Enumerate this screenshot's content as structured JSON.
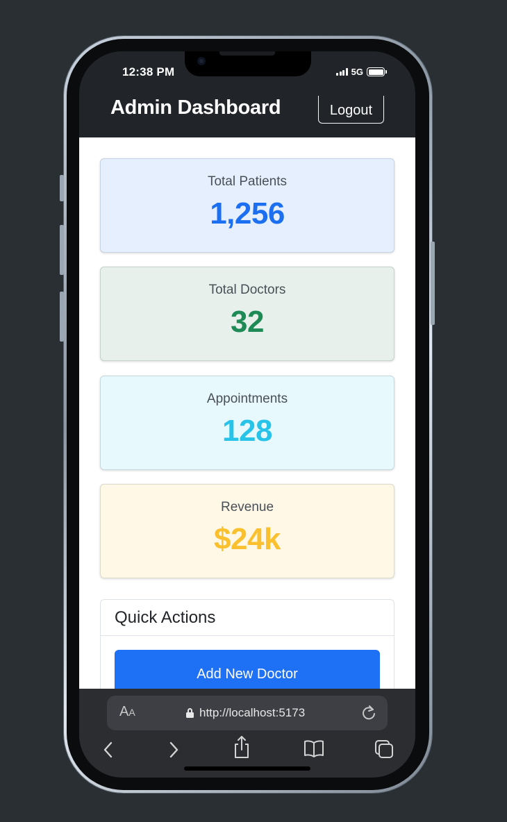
{
  "status_bar": {
    "time": "12:38 PM",
    "network": "5G"
  },
  "navbar": {
    "title": "Admin Dashboard",
    "logout_label": "Logout"
  },
  "stats": [
    {
      "label": "Total Patients",
      "value": "1,256",
      "color": "#1d6ff2"
    },
    {
      "label": "Total Doctors",
      "value": "32",
      "color": "#1e8a55"
    },
    {
      "label": "Appointments",
      "value": "128",
      "color": "#27c3e8"
    },
    {
      "label": "Revenue",
      "value": "$24k",
      "color": "#fbc02d"
    }
  ],
  "quick_actions": {
    "title": "Quick Actions",
    "add_doctor_label": "Add New Doctor"
  },
  "browser": {
    "reader_big": "A",
    "reader_small": "A",
    "url": "http://localhost:5173"
  },
  "icons": {
    "back": "chevron-left-icon",
    "forward": "chevron-right-icon",
    "share": "share-icon",
    "bookmarks": "book-icon",
    "tabs": "tabs-icon",
    "reload": "reload-icon",
    "lock": "lock-icon"
  },
  "colors": {
    "navbar_bg": "#212529",
    "primary": "#1e70f5",
    "browser_bar": "#2b2d31"
  }
}
